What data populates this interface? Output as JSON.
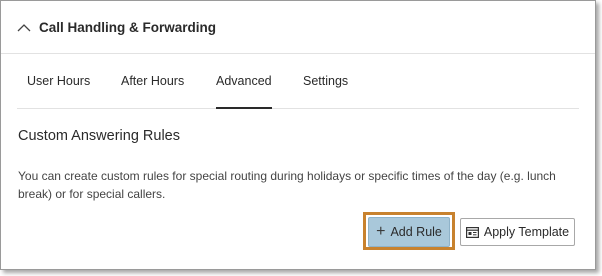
{
  "panel": {
    "title": "Call Handling & Forwarding",
    "collapse_icon": "chevron-up-icon"
  },
  "tabs": [
    {
      "label": "User Hours",
      "active": false
    },
    {
      "label": "After Hours",
      "active": false
    },
    {
      "label": "Advanced",
      "active": true
    },
    {
      "label": "Settings",
      "active": false
    }
  ],
  "section": {
    "title": "Custom Answering Rules",
    "description": "You can create custom rules for special routing during holidays or specific times of the day (e.g. lunch break) or for special callers."
  },
  "actions": {
    "add_rule": {
      "icon": "plus-icon",
      "label": "Add Rule"
    },
    "apply_template": {
      "icon": "template-icon",
      "label": "Apply Template"
    }
  },
  "colors": {
    "add_rule_bg": "#a9c8da",
    "highlight_border": "#c8822e",
    "text": "#2a2a2a"
  }
}
